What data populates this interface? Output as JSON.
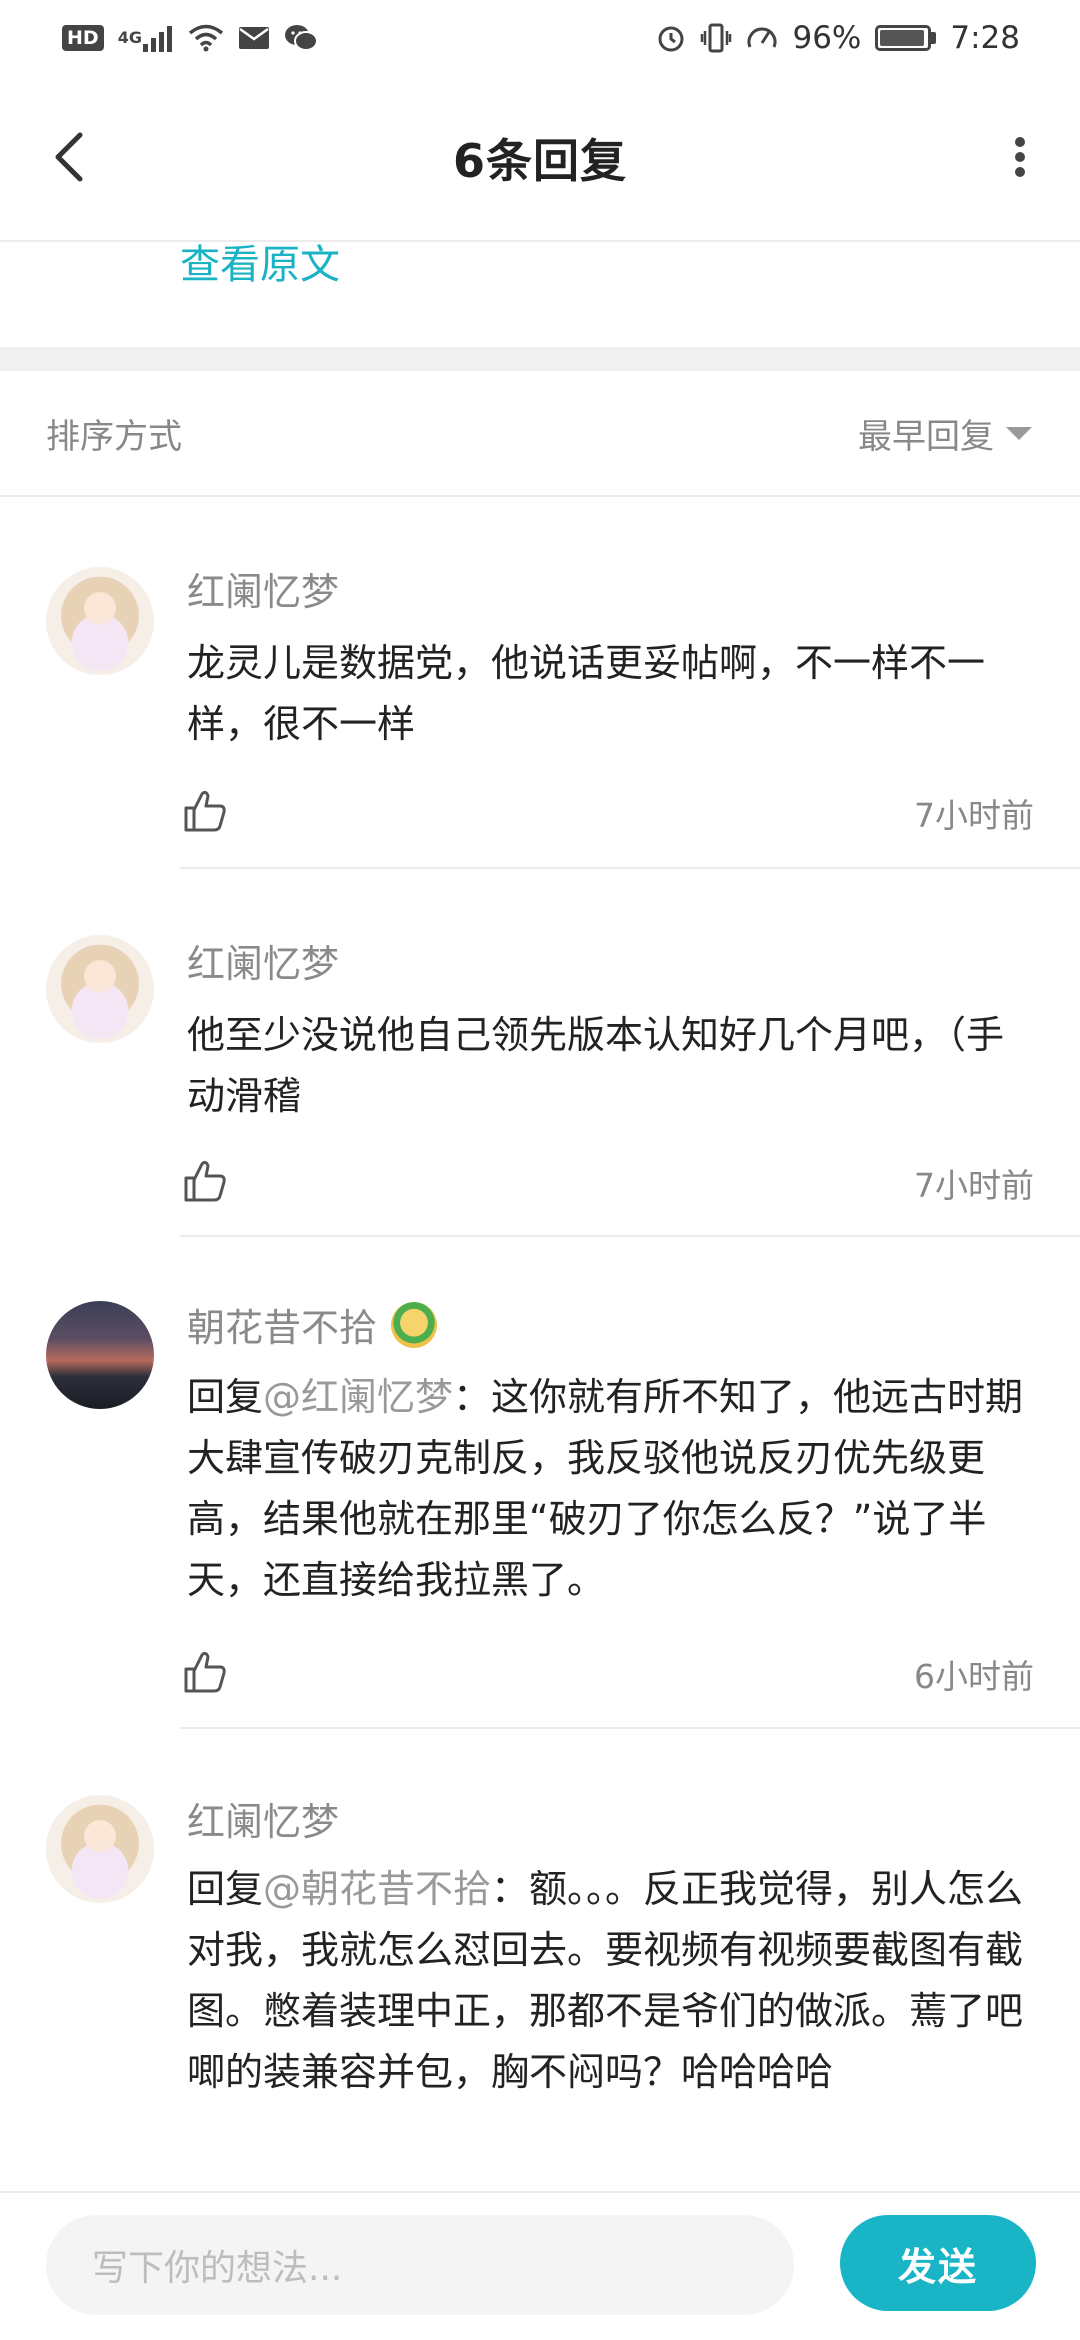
{
  "status_bar": {
    "hd": "HD",
    "network": "4G",
    "battery": "96%",
    "battery_level": 0.96,
    "time": "7:28",
    "icons": [
      "hd-icon",
      "signal-icon",
      "wifi-icon",
      "mail-icon",
      "wechat-icon",
      "alarm-icon",
      "vibrate-icon",
      "speed-icon",
      "battery-icon"
    ]
  },
  "header": {
    "title": "6条回复",
    "back_icon": "chevron-left-icon",
    "more_icon": "more-vertical-icon"
  },
  "view_original": "查看原文",
  "sort": {
    "label": "排序方式",
    "value": "最早回复"
  },
  "comments": [
    {
      "username": "红阑忆梦",
      "mention": "",
      "text": "龙灵儿是数据党，他说话更妥帖啊，不一样不一样，很不一样",
      "time": "7小时前"
    },
    {
      "username": "红阑忆梦",
      "mention": "",
      "text": "他至少没说他自己领先版本认知好几个月吧，（手动滑稽",
      "time": "7小时前"
    },
    {
      "username": "朝花昔不拾",
      "reply_prefix": "回复",
      "mention": "@红阑忆梦",
      "text": "：这你就有所不知了，他远古时期大肆宣传破刃克制反，我反驳他说反刃优先级更高，结果他就在那里“破刃了你怎么反？”说了半天，还直接给我拉黑了。",
      "time": "6小时前"
    },
    {
      "username": "红阑忆梦",
      "reply_prefix": "回复",
      "mention": "@朝花昔不拾",
      "text": "：额。。。反正我觉得，别人怎么对我，我就怎么怼回去。要视频有视频要截图有截图。憋着装理中正，那都不是爷们的做派。蔫了吧唧的装兼容并包，胸不闷吗？哈哈哈哈",
      "time": ""
    }
  ],
  "composer": {
    "placeholder": "写下你的想法...",
    "send_label": "发送"
  },
  "colors": {
    "accent": "#19b5c6",
    "link": "#1ab3c4",
    "muted": "#888888"
  }
}
